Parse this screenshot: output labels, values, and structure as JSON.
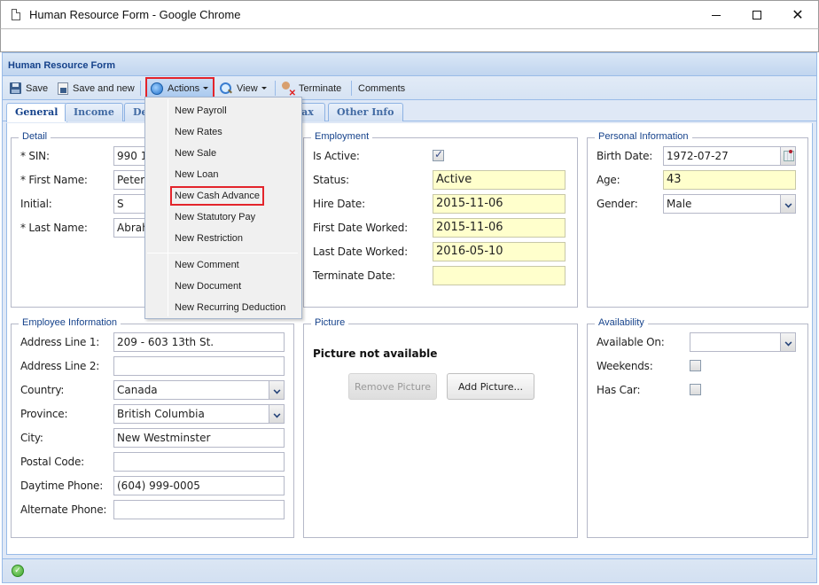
{
  "window": {
    "title": "Human Resource Form - Google Chrome",
    "controls": {
      "minimize": "minimize",
      "maximize": "maximize",
      "close": "✕"
    }
  },
  "app": {
    "header_title": "Human Resource Form",
    "toolbar": {
      "save": "Save",
      "save_and_new": "Save and new",
      "actions": "Actions",
      "view": "View",
      "terminate": "Terminate",
      "comments": "Comments"
    },
    "tabs": [
      {
        "label": "General",
        "active": true
      },
      {
        "label": "Income",
        "active": false
      },
      {
        "label": "Deductions",
        "active": false
      },
      {
        "label": "Tax",
        "active": false
      },
      {
        "label": "Other Info",
        "active": false
      }
    ],
    "actions_menu": {
      "items": [
        "New Payroll",
        "New Rates",
        "New Sale",
        "New Loan",
        "New Cash Advance",
        "New Statutory Pay",
        "New Restriction",
        "New Comment",
        "New Document",
        "New Recurring Deduction"
      ],
      "highlighted": "New Cash Advance"
    },
    "detail": {
      "legend": "Detail",
      "sin_label": "* SIN:",
      "sin_value": "990 1",
      "first_name_label": "* First Name:",
      "first_name_value": "Peter",
      "initial_label": "Initial:",
      "initial_value": "S",
      "last_name_label": "* Last Name:",
      "last_name_value": "Abrah"
    },
    "employment": {
      "legend": "Employment",
      "is_active_label": "Is Active:",
      "is_active": true,
      "status_label": "Status:",
      "status_value": "Active",
      "hire_date_label": "Hire Date:",
      "hire_date_value": "2015-11-06",
      "first_date_label": "First Date Worked:",
      "first_date_value": "2015-11-06",
      "last_date_label": "Last Date Worked:",
      "last_date_value": "2016-05-10",
      "terminate_date_label": "Terminate Date:",
      "terminate_date_value": ""
    },
    "personal": {
      "legend": "Personal Information",
      "birth_date_label": "Birth Date:",
      "birth_date_value": "1972-07-27",
      "age_label": "Age:",
      "age_value": "43",
      "gender_label": "Gender:",
      "gender_value": "Male"
    },
    "employee_info": {
      "legend": "Employee Information",
      "address1_label": "Address Line 1:",
      "address1_value": "209 - 603 13th St.",
      "address2_label": "Address Line 2:",
      "address2_value": "",
      "country_label": "Country:",
      "country_value": "Canada",
      "province_label": "Province:",
      "province_value": "British Columbia",
      "city_label": "City:",
      "city_value": "New Westminster",
      "postal_label": "Postal Code:",
      "postal_value": "",
      "day_phone_label": "Daytime Phone:",
      "day_phone_value": "(604) 999-0005",
      "alt_phone_label": "Alternate Phone:",
      "alt_phone_value": ""
    },
    "picture": {
      "legend": "Picture",
      "message": "Picture not available",
      "remove_button": "Remove Picture",
      "add_button": "Add Picture..."
    },
    "availability": {
      "legend": "Availability",
      "available_on_label": "Available On:",
      "available_on_value": "",
      "weekends_label": "Weekends:",
      "weekends": false,
      "has_car_label": "Has Car:",
      "has_car": false
    },
    "status": {
      "icon": "ok-check-icon"
    }
  }
}
